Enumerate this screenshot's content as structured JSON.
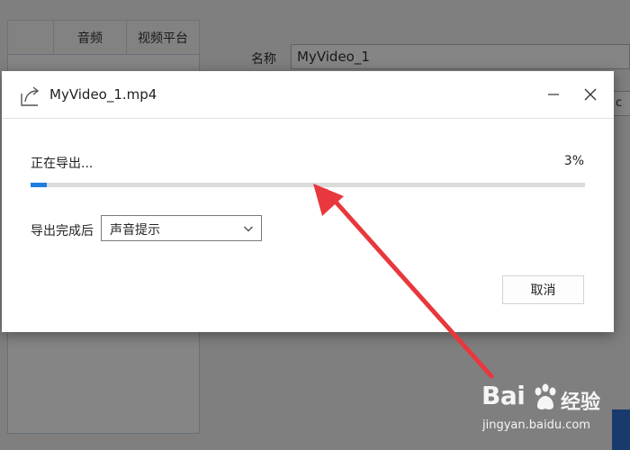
{
  "background_app": {
    "tabs": [
      "音频",
      "视频平台"
    ],
    "name_label": "名称",
    "name_value": "MyVideo_1",
    "small_field_value": "c"
  },
  "dialog": {
    "title": "MyVideo_1.mp4",
    "title_icon": "export-share-icon",
    "status_text": "正在导出...",
    "percent_text": "3%",
    "progress_fraction": 0.03,
    "after_export_label": "导出完成后",
    "after_export_value": "声音提示",
    "cancel_label": "取消"
  },
  "watermark": {
    "brand_latin": "Bai",
    "brand_cn": "经验",
    "url": "jingyan.baidu.com"
  },
  "colors": {
    "accent": "#1e7de0",
    "annotation": "#e8383d"
  }
}
